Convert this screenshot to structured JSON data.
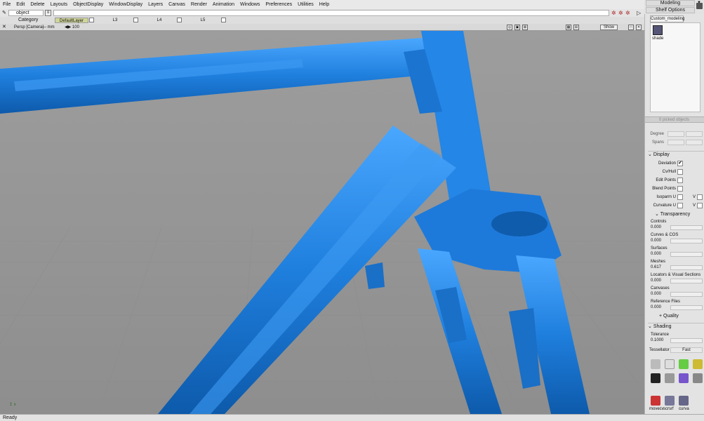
{
  "menu": [
    "File",
    "Edit",
    "Delete",
    "Layouts",
    "ObjectDisplay",
    "WindowDisplay",
    "Layers",
    "Canvas",
    "Render",
    "Animation",
    "Windows",
    "Preferences",
    "Utilities",
    "Help"
  ],
  "top_right": {
    "workspace": "Modeling",
    "shelf_options": "Shelf Options"
  },
  "toolbar": {
    "pick_mode": "object"
  },
  "layers": {
    "category_label": "Category",
    "items": [
      "DefaultLayer",
      "L3",
      "L4",
      "L5"
    ]
  },
  "viewport": {
    "title": "Persp [Camera]",
    "unit": "mm",
    "scale": "100",
    "show_label": "Show",
    "mesh_color": "#1f7fdd",
    "floor_color": "#9a9a9a",
    "grid_color": "#8c8c8c"
  },
  "shelf": {
    "tab": "Custom_modeling",
    "tool": "shade"
  },
  "panel": {
    "picked": "0 picked objects",
    "degree_label": "Degree",
    "spans_label": "Spans",
    "display": {
      "title": "Display",
      "items": [
        {
          "label": "Deviation",
          "checked": "✔"
        },
        {
          "label": "Cv/Hull",
          "checked": ""
        },
        {
          "label": "Edit Points",
          "checked": ""
        },
        {
          "label": "Blend Points",
          "checked": ""
        },
        {
          "label": "Isoparm U",
          "checked": ""
        },
        {
          "label": "Curvature U",
          "checked": ""
        }
      ],
      "v_label": "V"
    },
    "transparency": {
      "title": "Transparency",
      "items": [
        {
          "label": "Controls",
          "value": "0.000"
        },
        {
          "label": "Curves & COS",
          "value": "0.000"
        },
        {
          "label": "Surfaces",
          "value": "0.000"
        },
        {
          "label": "Meshes",
          "value": "0.617"
        },
        {
          "label": "Locators & Visual Sections",
          "value": "0.000"
        },
        {
          "label": "Canvases",
          "value": "0.000"
        },
        {
          "label": "Reference Files",
          "value": "0.000"
        }
      ]
    },
    "quality": {
      "title": "Quality"
    },
    "shading": {
      "title": "Shading",
      "tolerance_label": "Tolerance",
      "tolerance_value": "0.1000",
      "tessellator_label": "Tessellator",
      "tessellator_value": "Fast"
    },
    "bottom_tools": [
      "movecv",
      "scrsrf",
      "curva"
    ]
  },
  "status": "Ready"
}
